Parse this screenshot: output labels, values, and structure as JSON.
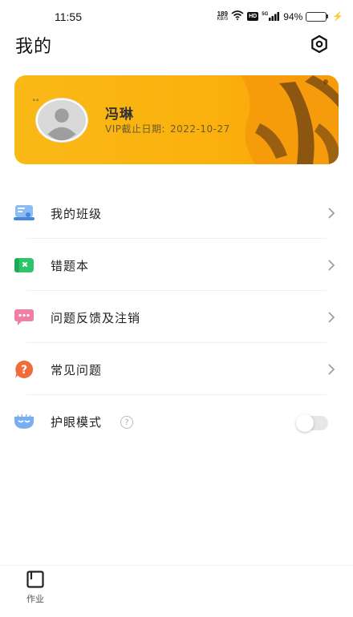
{
  "status_bar": {
    "time": "11:55",
    "net_speed_value": "189",
    "net_speed_unit": "KB/S",
    "hd": "HD",
    "signal_type": "5G",
    "battery_percent": "94%",
    "battery_level": 0.94
  },
  "header": {
    "title": "我的",
    "settings_icon": "settings-hexagon-icon"
  },
  "profile": {
    "name": "冯琳",
    "vip_label": "VIP截止日期:",
    "vip_date": "2022-10-27"
  },
  "menu": {
    "items": [
      {
        "label": "我的班级",
        "icon": "class-icon",
        "color": "#6ea4f0"
      },
      {
        "label": "错题本",
        "icon": "wrong-book-icon",
        "color": "#2ec46a"
      },
      {
        "label": "问题反馈及注销",
        "icon": "feedback-icon",
        "color": "#f0739a"
      },
      {
        "label": "常见问题",
        "icon": "faq-icon",
        "color": "#f26b3a"
      }
    ],
    "eye_mode": {
      "label": "护眼模式",
      "help": "?",
      "enabled": false
    }
  },
  "bottom_nav": {
    "tabs": [
      {
        "label": "作业",
        "icon": "homework-icon"
      }
    ]
  },
  "colors": {
    "card_primary": "#fbb10d",
    "card_dark": "#8a5a1a",
    "battery": "#3b6fe0"
  }
}
